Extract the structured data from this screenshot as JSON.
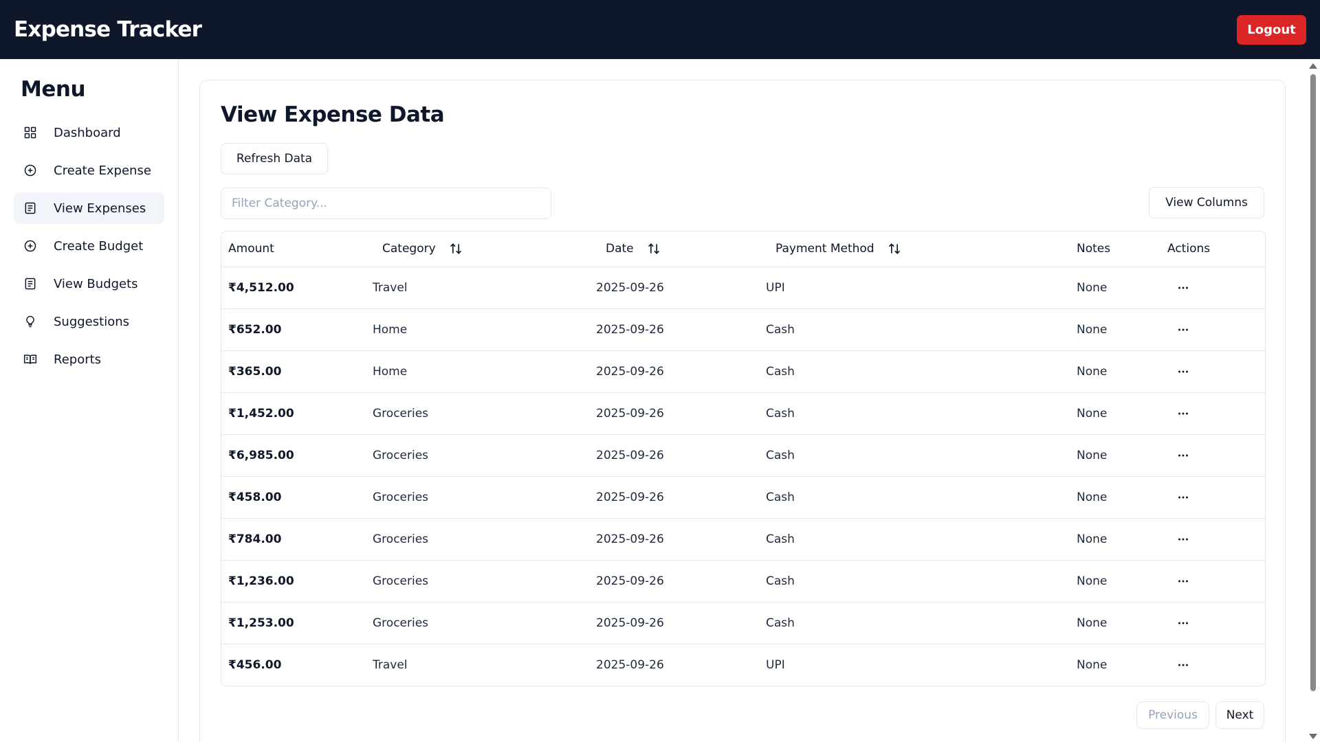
{
  "header": {
    "title": "Expense Tracker",
    "logout_label": "Logout"
  },
  "sidebar": {
    "title": "Menu",
    "items": [
      {
        "label": "Dashboard",
        "icon": "grid-icon"
      },
      {
        "label": "Create Expense",
        "icon": "plus-circle-icon"
      },
      {
        "label": "View Expenses",
        "icon": "list-icon",
        "active": true
      },
      {
        "label": "Create Budget",
        "icon": "plus-circle-icon"
      },
      {
        "label": "View Budgets",
        "icon": "list-icon"
      },
      {
        "label": "Suggestions",
        "icon": "lightbulb-icon"
      },
      {
        "label": "Reports",
        "icon": "book-icon"
      }
    ]
  },
  "main": {
    "title": "View Expense Data",
    "refresh_label": "Refresh Data",
    "filter_placeholder": "Filter Category...",
    "view_columns_label": "View Columns",
    "previous_label": "Previous",
    "next_label": "Next"
  },
  "table": {
    "columns": [
      "Amount",
      "Category",
      "Date",
      "Payment Method",
      "Notes",
      "Actions"
    ],
    "rows": [
      {
        "amount": "₹4,512.00",
        "category": "Travel",
        "date": "2025-09-26",
        "payment": "UPI",
        "notes": "None"
      },
      {
        "amount": "₹652.00",
        "category": "Home",
        "date": "2025-09-26",
        "payment": "Cash",
        "notes": "None"
      },
      {
        "amount": "₹365.00",
        "category": "Home",
        "date": "2025-09-26",
        "payment": "Cash",
        "notes": "None"
      },
      {
        "amount": "₹1,452.00",
        "category": "Groceries",
        "date": "2025-09-26",
        "payment": "Cash",
        "notes": "None"
      },
      {
        "amount": "₹6,985.00",
        "category": "Groceries",
        "date": "2025-09-26",
        "payment": "Cash",
        "notes": "None"
      },
      {
        "amount": "₹458.00",
        "category": "Groceries",
        "date": "2025-09-26",
        "payment": "Cash",
        "notes": "None"
      },
      {
        "amount": "₹784.00",
        "category": "Groceries",
        "date": "2025-09-26",
        "payment": "Cash",
        "notes": "None"
      },
      {
        "amount": "₹1,236.00",
        "category": "Groceries",
        "date": "2025-09-26",
        "payment": "Cash",
        "notes": "None"
      },
      {
        "amount": "₹1,253.00",
        "category": "Groceries",
        "date": "2025-09-26",
        "payment": "Cash",
        "notes": "None"
      },
      {
        "amount": "₹456.00",
        "category": "Travel",
        "date": "2025-09-26",
        "payment": "UPI",
        "notes": "None"
      }
    ]
  },
  "colors": {
    "topbar": "#0f172a",
    "logout": "#dc2626",
    "active_nav": "#f1f5f9",
    "border": "#e2e8f0"
  }
}
